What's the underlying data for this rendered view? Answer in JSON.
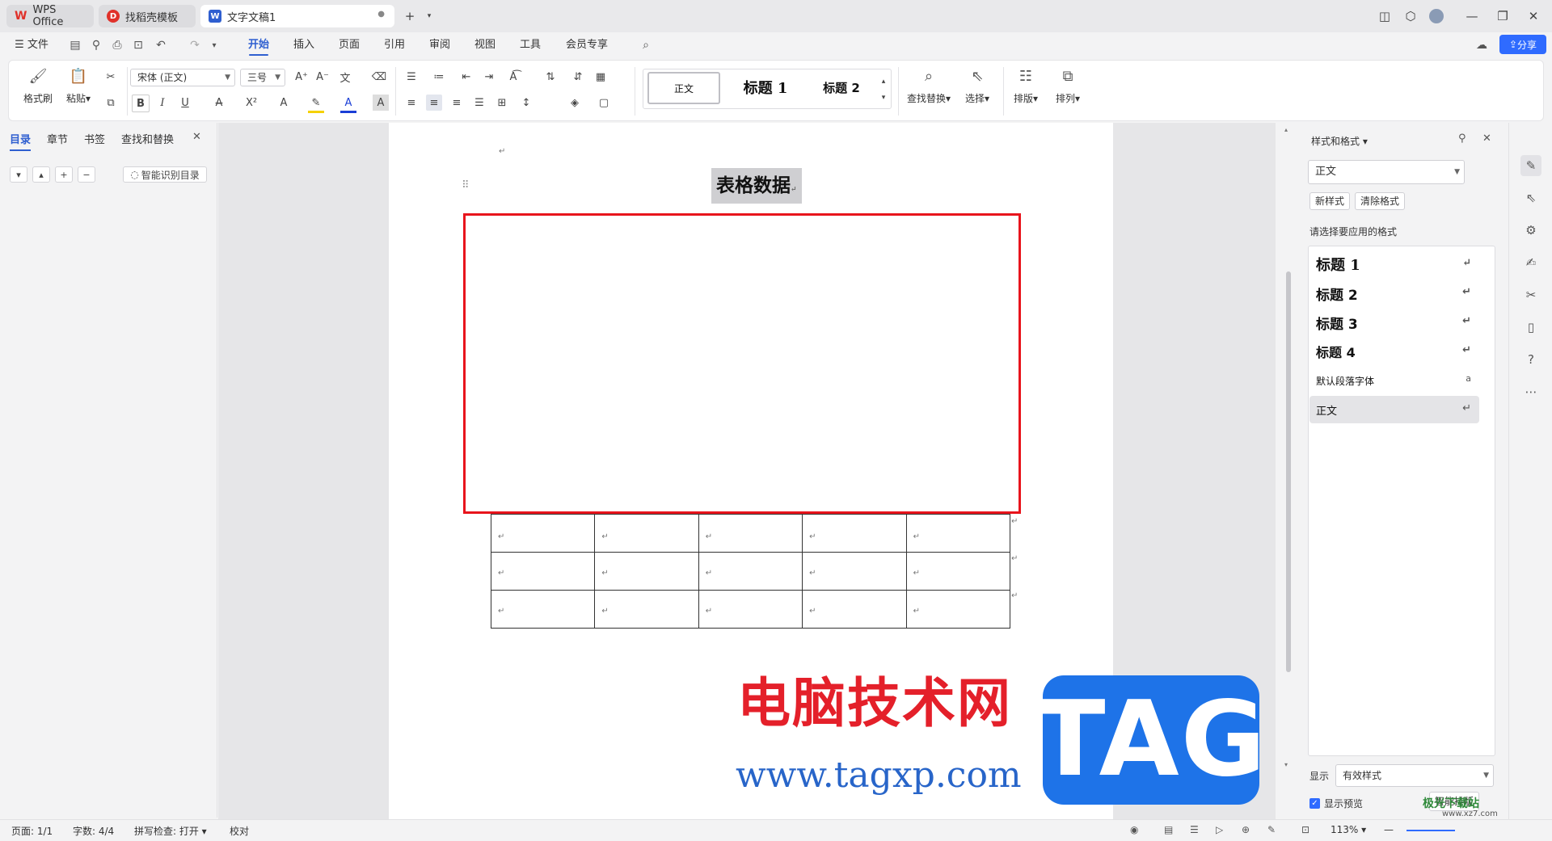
{
  "titlebar": {
    "tabs": [
      {
        "label": "WPS Office",
        "icon": "wps-logo-icon",
        "color": "#e0312a"
      },
      {
        "label": "找稻壳模板",
        "icon": "docer-icon",
        "color": "#e0312a"
      },
      {
        "label": "文字文稿1",
        "icon": "writer-doc-icon",
        "color": "#2f5fd0"
      }
    ],
    "new_tab": "+"
  },
  "menu": {
    "file": "文件",
    "items": [
      "开始",
      "插入",
      "页面",
      "引用",
      "审阅",
      "视图",
      "工具",
      "会员专享"
    ],
    "active": "开始",
    "share": "分享"
  },
  "ribbon": {
    "format_painter": "格式刷",
    "paste": "粘贴",
    "font_name": "宋体 (正文)",
    "font_size": "三号",
    "styles": [
      "正文",
      "标题 1",
      "标题 2"
    ],
    "find_replace": "查找替换",
    "select": "选择",
    "layout": "排版",
    "arrange": "排列"
  },
  "left_panel": {
    "tabs": [
      "目录",
      "章节",
      "书签",
      "查找和替换"
    ],
    "active": "目录",
    "smart_toc": "智能识别目录"
  },
  "document": {
    "title": "表格数据",
    "table": {
      "rows": 3,
      "cols": 5
    }
  },
  "watermark": {
    "brand": "电脑技术网",
    "url": "www.tagxp.com",
    "tag": "TAG",
    "corner": "极光下载站",
    "corner_url": "www.xz7.com"
  },
  "right_panel": {
    "title": "样式和格式",
    "current_style": "正文",
    "new_style": "新样式",
    "clear_format": "清除格式",
    "prompt": "请选择要应用的格式",
    "styles": [
      "标题 1",
      "标题 2",
      "标题 3",
      "标题 4",
      "默认段落字体",
      "正文"
    ],
    "show_label": "显示",
    "show_value": "有效样式",
    "preview_label": "显示预览",
    "smart_layout": "智能排版"
  },
  "statusbar": {
    "page": "页面: 1/1",
    "words": "字数: 4/4",
    "spell": "拼写检查: 打开",
    "proof": "校对",
    "zoom": "113%"
  },
  "colors": {
    "accent": "#2f5fd0",
    "highlight_box": "#e8141c",
    "tag_blue": "#1e73e8",
    "watermark_red": "#e4202a"
  }
}
